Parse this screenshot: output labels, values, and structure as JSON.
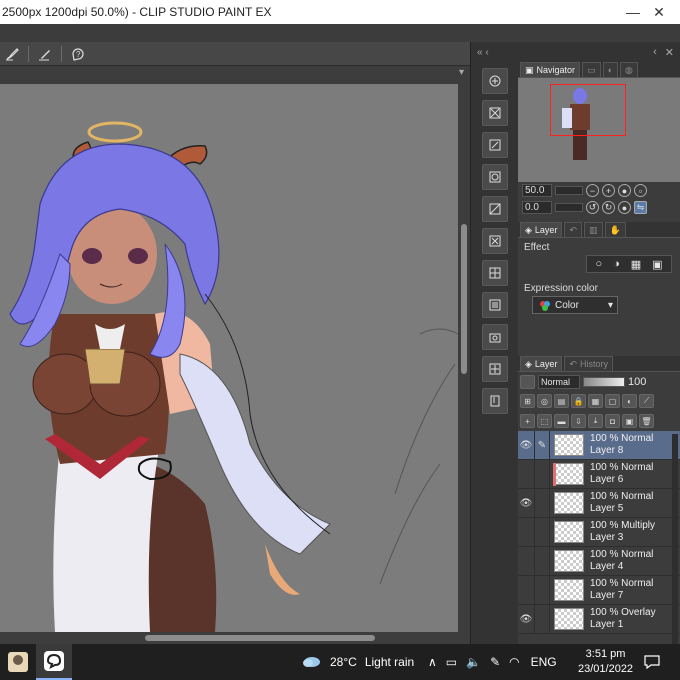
{
  "window": {
    "title": "2500px 1200dpi 50.0%)  - CLIP STUDIO PAINT EX",
    "minimize": "—",
    "maximize": "◻",
    "close": "✕"
  },
  "toolbar": {
    "icons": [
      "brush-tool-icon",
      "pen-tool-icon",
      "help-icon"
    ]
  },
  "sidebar_strip": {
    "collapse_label": "«  ‹",
    "tools": [
      "transform-icon",
      "clear-icon",
      "edit-icon",
      "image-icon",
      "transform2-icon",
      "delete-icon",
      "grid-icon",
      "settings-icon",
      "camera-icon",
      "fit-icon",
      "ruler-icon"
    ]
  },
  "navigator": {
    "tab_label": "Navigator",
    "zoom_value": "50.0",
    "rotate_value": "0.0"
  },
  "layer_property": {
    "tab_label": "Layer",
    "effect_label": "Effect",
    "expression_label": "Expression color",
    "expression_value": "Color"
  },
  "layer_panel": {
    "tabs": [
      "Layer",
      "History"
    ],
    "blend_mode": "Normal",
    "opacity": "100",
    "layers": [
      {
        "mode": "100 % Normal",
        "name": "Layer 8",
        "visible": true,
        "selected": true,
        "clipped": false
      },
      {
        "mode": "100 % Normal",
        "name": "Layer 6",
        "visible": false,
        "selected": false,
        "clipped": true
      },
      {
        "mode": "100 % Normal",
        "name": "Layer 5",
        "visible": true,
        "selected": false,
        "clipped": false
      },
      {
        "mode": "100 % Multiply",
        "name": "Layer 3",
        "visible": false,
        "selected": false,
        "clipped": false
      },
      {
        "mode": "100 % Normal",
        "name": "Layer 4",
        "visible": false,
        "selected": false,
        "clipped": false
      },
      {
        "mode": "100 % Normal",
        "name": "Layer 7",
        "visible": false,
        "selected": false,
        "clipped": false
      },
      {
        "mode": "100 % Overlay",
        "name": "Layer 1",
        "visible": true,
        "selected": false,
        "clipped": false
      }
    ]
  },
  "taskbar": {
    "weather_temp": "28°C",
    "weather_text": "Light rain",
    "language": "ENG",
    "time": "3:51 pm",
    "date": "23/01/2022"
  }
}
